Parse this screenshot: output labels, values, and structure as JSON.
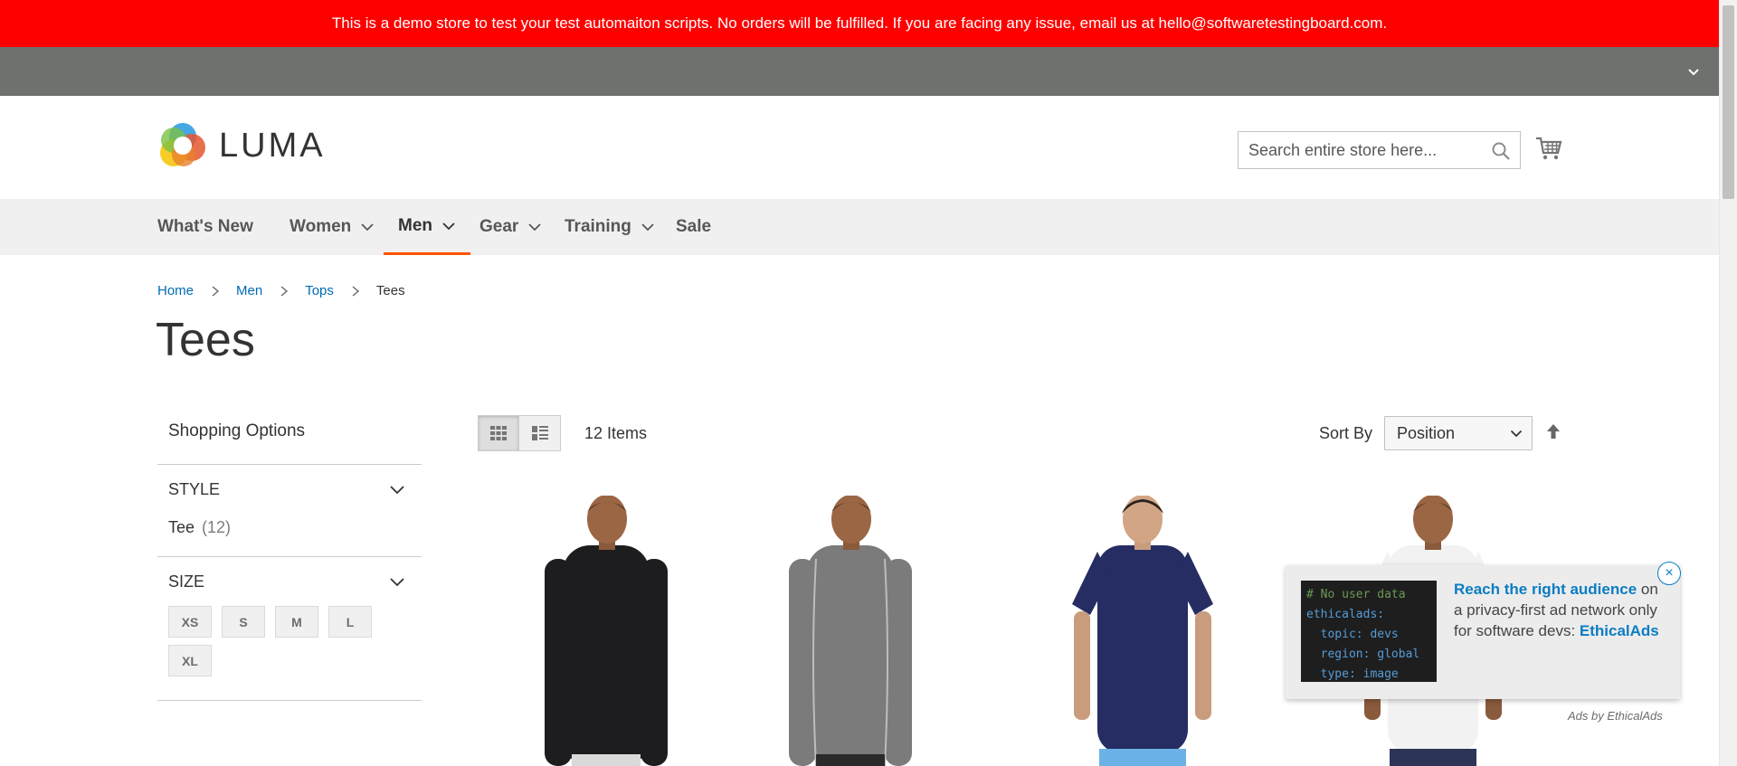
{
  "banner": {
    "text": "This is a demo store to test your test automaiton scripts. No orders will be fulfilled. If you are facing any issue, email us at hello@softwaretestingboard.com."
  },
  "header": {
    "logo_text": "LUMA",
    "search_placeholder": "Search entire store here...",
    "search_value": "",
    "search_icon": "search-icon",
    "cart_icon": "cart-icon"
  },
  "nav": {
    "items": [
      {
        "label": "What's New",
        "dropdown": false,
        "active": false
      },
      {
        "label": "Women",
        "dropdown": true,
        "active": false
      },
      {
        "label": "Men",
        "dropdown": true,
        "active": true
      },
      {
        "label": "Gear",
        "dropdown": true,
        "active": false
      },
      {
        "label": "Training",
        "dropdown": true,
        "active": false
      },
      {
        "label": "Sale",
        "dropdown": false,
        "active": false
      }
    ],
    "active_color": "#ff5501"
  },
  "breadcrumbs": [
    "Home",
    "Men",
    "Tops",
    "Tees"
  ],
  "page_title": "Tees",
  "sidebar": {
    "title": "Shopping Options",
    "filters": [
      {
        "name": "STYLE",
        "options": [
          {
            "label": "Tee",
            "count": "(12)"
          }
        ]
      },
      {
        "name": "SIZE",
        "sizes": [
          "XS",
          "S",
          "M",
          "L",
          "XL"
        ]
      }
    ]
  },
  "toolbar": {
    "view_modes": [
      "grid-icon",
      "list-icon"
    ],
    "active_mode": "grid",
    "items_count": "12 Items",
    "sort_label": "Sort By",
    "sort_value": "Position",
    "sort_dir_icon": "sort-arrow-up-icon"
  },
  "products": [
    {
      "shirt_color": "#1d1d1f",
      "sleeves": "long"
    },
    {
      "shirt_color": "#7b7b7b",
      "sleeves": "long"
    },
    {
      "shirt_color": "#252d63",
      "sleeves": "short"
    },
    {
      "shirt_color": "#f2f2f2",
      "sleeves": "short"
    }
  ],
  "ad": {
    "code_lines": [
      "# No user data",
      "ethicalads:",
      "  topic: devs",
      "  region: global",
      "  type: image"
    ],
    "headline": "Reach the right audience",
    "body_1": " on",
    "body_2": "a privacy-first ad network only for software devs:",
    "brand": "EthicalAds",
    "close_label": "×",
    "credit": "Ads by EthicalAds"
  },
  "colors": {
    "banner_bg": "#fe0000",
    "panel_bg": "#6e716e",
    "nav_bg": "#f0f0f0",
    "link": "#006bb4",
    "ad_accent": "#0b7dc2"
  }
}
